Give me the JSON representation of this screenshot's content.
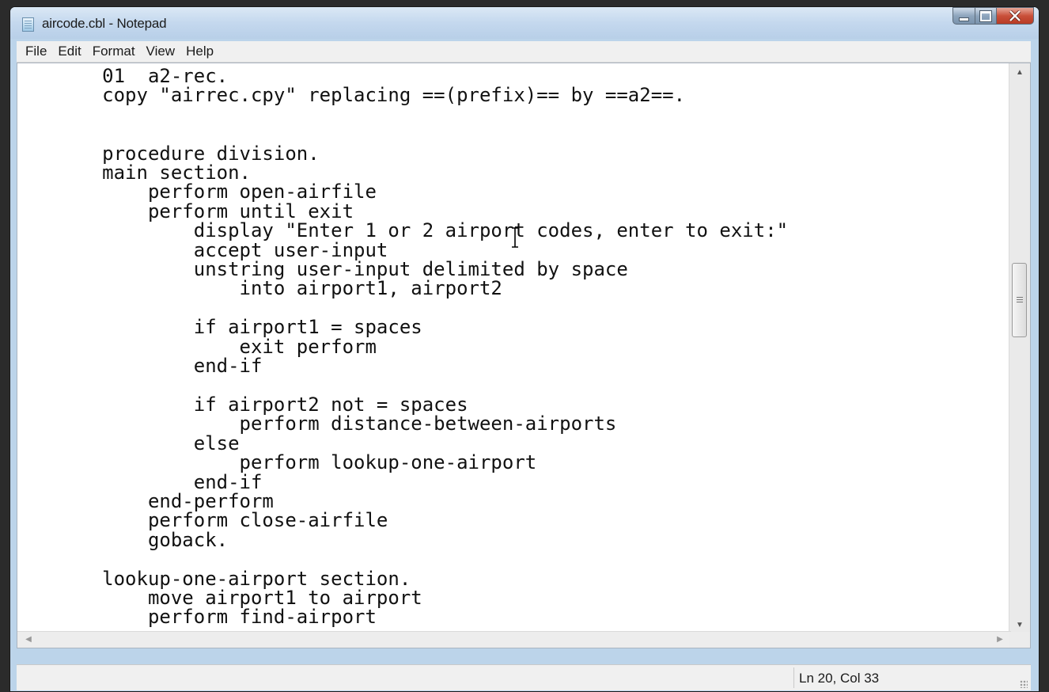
{
  "window": {
    "title": "aircode.cbl - Notepad"
  },
  "menu": [
    "File",
    "Edit",
    "Format",
    "View",
    "Help"
  ],
  "editor": {
    "text": "       01  a2-rec.\n       copy \"airrec.cpy\" replacing ==(prefix)== by ==a2==.\n\n\n       procedure division.\n       main section.\n           perform open-airfile\n           perform until exit\n               display \"Enter 1 or 2 airport codes, enter to exit:\"\n               accept user-input\n               unstring user-input delimited by space\n                   into airport1, airport2\n\n               if airport1 = spaces\n                   exit perform\n               end-if\n\n               if airport2 not = spaces\n                   perform distance-between-airports\n               else\n                   perform lookup-one-airport\n               end-if\n           end-perform\n           perform close-airfile\n           goback.\n\n       lookup-one-airport section.\n           move airport1 to airport\n           perform find-airport"
  },
  "status": {
    "position": "Ln 20, Col 33"
  }
}
